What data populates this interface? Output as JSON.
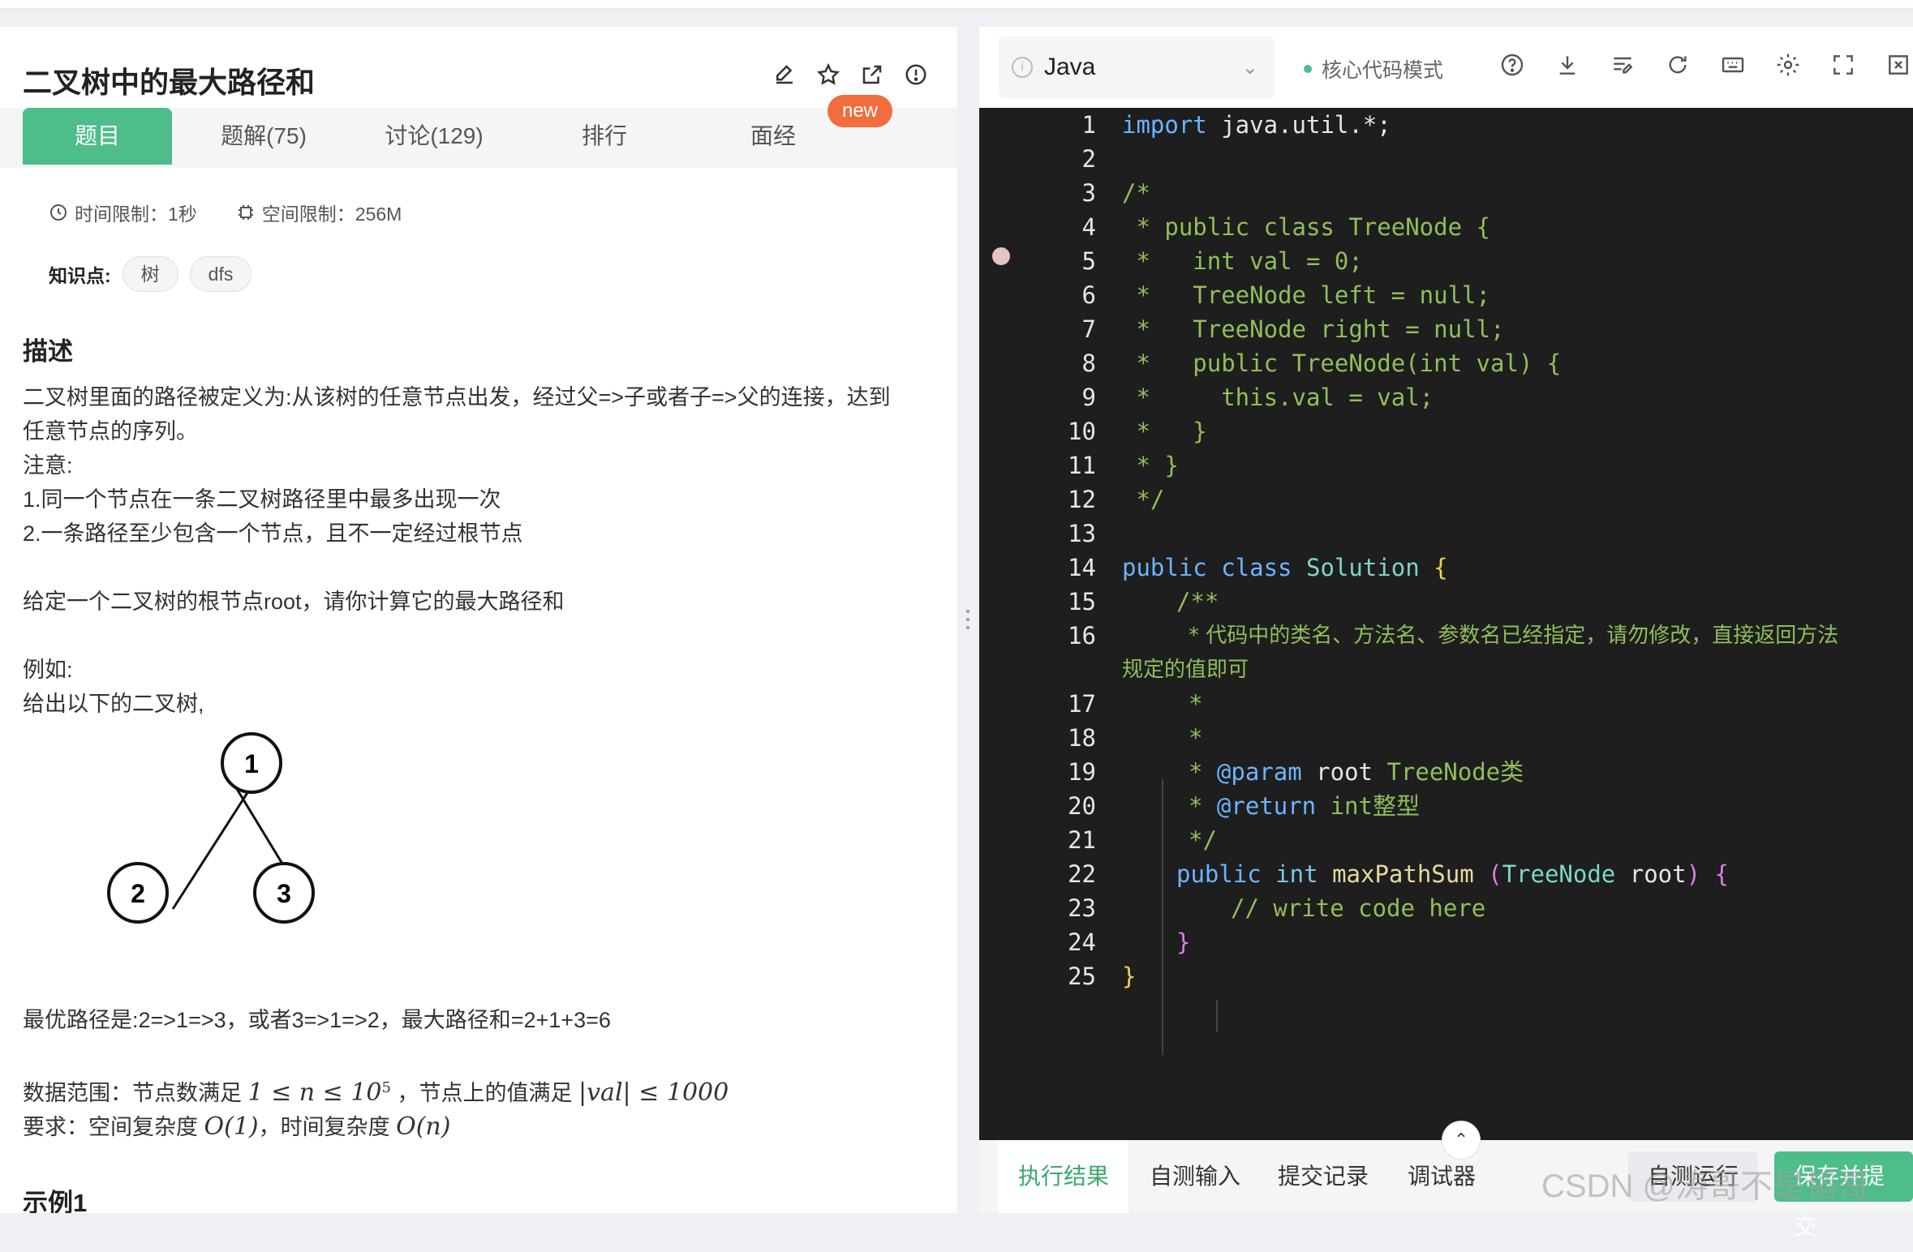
{
  "problem": {
    "title": "二叉树中的最大路径和",
    "tabs": [
      "题目",
      "题解(75)",
      "讨论(129)",
      "排行",
      "面经"
    ],
    "new_badge": "new",
    "time_limit": "时间限制：1秒",
    "space_limit": "空间限制：256M",
    "knowledge_label": "知识点:",
    "tags": [
      "树",
      "dfs"
    ],
    "desc_heading": "描述",
    "desc_lines": [
      "二叉树里面的路径被定义为:从该树的任意节点出发，经过父=>子或者子=>父的连接，达到",
      "任意节点的序列。",
      "注意:",
      "1.同一个节点在一条二叉树路径里中最多出现一次",
      "2.一条路径至少包含一个节点，且不一定经过根节点"
    ],
    "task_line": "给定一个二叉树的根节点root，请你计算它的最大路径和",
    "example_label": "例如:",
    "example_text": "给出以下的二叉树,",
    "tree_nodes": [
      "1",
      "2",
      "3"
    ],
    "best_path": "最优路径是:2=>1=>3，或者3=>1=>2，最大路径和=2+1+3=6",
    "range_prefix": "数据范围：节点数满足",
    "range_n": "1 ≤ n ≤ 10",
    "range_exp": "5",
    "range_mid": "，节点上的值满足",
    "range_val": "|val| ≤ 1000",
    "req_prefix": "要求：空间复杂度",
    "req_space": "O(1)",
    "req_mid": "，时间复杂度",
    "req_time": "O(n)",
    "example1": "示例1"
  },
  "editor": {
    "language": "Java",
    "mode": "核心代码模式",
    "line_numbers": [
      "1",
      "2",
      "3",
      "4",
      "5",
      "6",
      "7",
      "8",
      "9",
      "10",
      "11",
      "12",
      "13",
      "14",
      "15",
      "16",
      "17",
      "18",
      "19",
      "20",
      "21",
      "22",
      "23",
      "24",
      "25"
    ],
    "code": {
      "l1_kw": "import",
      "l1_rest": " java.util.*;",
      "l3": "/*",
      "l4": " * public class TreeNode {",
      "l5": " *   int val = 0;",
      "l6": " *   TreeNode left = null;",
      "l7": " *   TreeNode right = null;",
      "l8": " *   public TreeNode(int val) {",
      "l9": " *     this.val = val;",
      "l10": " *   }",
      "l11": " * }",
      "l12": " */",
      "l14_kw": "public class",
      "l14_cls": "Solution",
      "l14_br": "{",
      "l15": "/**",
      "l16a": "* 代码中的类名、方法名、参数名已经指定，请勿修改，直接返回方法",
      "l16b": "规定的值即可",
      "l17": "*",
      "l18": "*",
      "l19_star": "* ",
      "l19_tag": "@param",
      "l19_name": " root",
      "l19_rest": " TreeNode类",
      "l20_star": "* ",
      "l20_tag": "@return",
      "l20_rest": " int整型",
      "l21": "*/",
      "l22_kw": "public",
      "l22_ty": " int",
      "l22_fn": " maxPathSum",
      "l22_p1": " (",
      "l22_cls": "TreeNode",
      "l22_arg": " root",
      "l22_p2": ")",
      "l22_br": " {",
      "l23": "// write code here",
      "l24": "}",
      "l25": "}"
    }
  },
  "bottom": {
    "tabs": [
      "执行结果",
      "自测输入",
      "提交记录",
      "调试器"
    ],
    "run_button": "自测运行",
    "submit_button": "保存并提交"
  },
  "watermark": "CSDN @涛哥不是韬哥"
}
